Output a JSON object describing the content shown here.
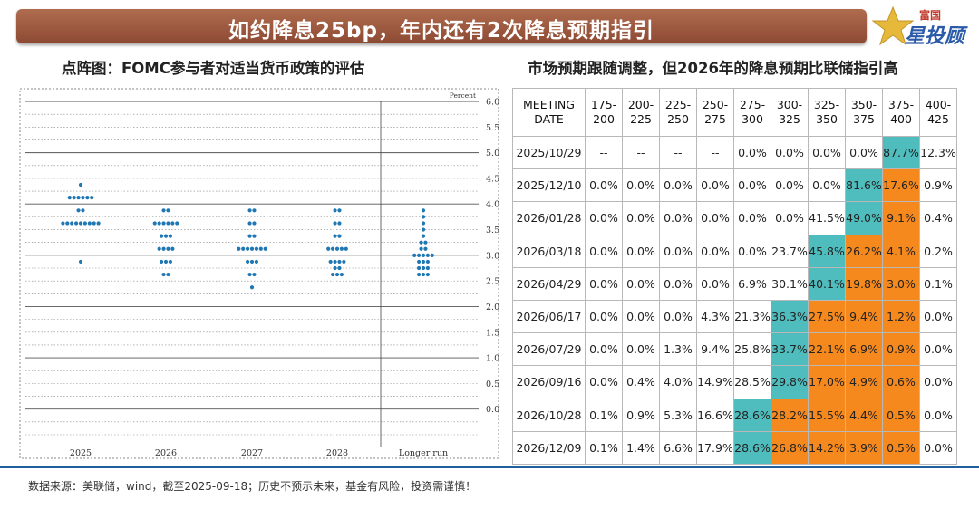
{
  "banner": {
    "title": "如约降息25bp，年内还有2次降息预期指引"
  },
  "logo": {
    "top": "富国",
    "main": "星投顾"
  },
  "left_chart": {
    "subtitle": "点阵图：FOMC参与者对适当货币政策的评估"
  },
  "right_table": {
    "subtitle": "市场预期跟随调整，但2026年的降息预期比联储指引高"
  },
  "footer": {
    "text": "数据来源：美联储，wind，截至2025-09-18；历史不预示未来，基金有风险，投资需谨慎！"
  },
  "colors": {
    "banner": "#9a5840",
    "dot": "#1f77b4",
    "teal": "#4fbdbd",
    "orange": "#f5891e",
    "footer_line": "#1f5f9e"
  },
  "chart_data": [
    {
      "type": "scatter",
      "title": "",
      "ylabel": "Percent",
      "ylim": [
        -0.5,
        6.0
      ],
      "yticks": [
        "6.0",
        "5.5",
        "5.0",
        "4.5",
        "4.0",
        "3.5",
        "3.0",
        "2.5",
        "2.0",
        "1.5",
        "1.0",
        "0.5",
        "0.0"
      ],
      "categories": [
        "2025",
        "2026",
        "2027",
        "2028",
        "Longer run"
      ],
      "dots": [
        {
          "category": "2025",
          "rate": 4.375,
          "count": 1
        },
        {
          "category": "2025",
          "rate": 4.125,
          "count": 6
        },
        {
          "category": "2025",
          "rate": 3.875,
          "count": 2
        },
        {
          "category": "2025",
          "rate": 3.625,
          "count": 9
        },
        {
          "category": "2025",
          "rate": 2.875,
          "count": 1
        },
        {
          "category": "2026",
          "rate": 3.875,
          "count": 2
        },
        {
          "category": "2026",
          "rate": 3.625,
          "count": 6
        },
        {
          "category": "2026",
          "rate": 3.375,
          "count": 3
        },
        {
          "category": "2026",
          "rate": 3.125,
          "count": 4
        },
        {
          "category": "2026",
          "rate": 2.875,
          "count": 3
        },
        {
          "category": "2026",
          "rate": 2.625,
          "count": 2
        },
        {
          "category": "2027",
          "rate": 3.875,
          "count": 2
        },
        {
          "category": "2027",
          "rate": 3.625,
          "count": 2
        },
        {
          "category": "2027",
          "rate": 3.375,
          "count": 2
        },
        {
          "category": "2027",
          "rate": 3.125,
          "count": 7
        },
        {
          "category": "2027",
          "rate": 2.875,
          "count": 3
        },
        {
          "category": "2027",
          "rate": 2.625,
          "count": 2
        },
        {
          "category": "2027",
          "rate": 2.375,
          "count": 1
        },
        {
          "category": "2028",
          "rate": 3.875,
          "count": 2
        },
        {
          "category": "2028",
          "rate": 3.625,
          "count": 2
        },
        {
          "category": "2028",
          "rate": 3.375,
          "count": 2
        },
        {
          "category": "2028",
          "rate": 3.125,
          "count": 5
        },
        {
          "category": "2028",
          "rate": 2.875,
          "count": 4
        },
        {
          "category": "2028",
          "rate": 2.75,
          "count": 2
        },
        {
          "category": "2028",
          "rate": 2.625,
          "count": 3
        },
        {
          "category": "Longer run",
          "rate": 3.875,
          "count": 1
        },
        {
          "category": "Longer run",
          "rate": 3.75,
          "count": 1
        },
        {
          "category": "Longer run",
          "rate": 3.625,
          "count": 1
        },
        {
          "category": "Longer run",
          "rate": 3.5,
          "count": 1
        },
        {
          "category": "Longer run",
          "rate": 3.375,
          "count": 1
        },
        {
          "category": "Longer run",
          "rate": 3.25,
          "count": 2
        },
        {
          "category": "Longer run",
          "rate": 3.125,
          "count": 2
        },
        {
          "category": "Longer run",
          "rate": 3.0,
          "count": 5
        },
        {
          "category": "Longer run",
          "rate": 2.875,
          "count": 3
        },
        {
          "category": "Longer run",
          "rate": 2.75,
          "count": 3
        },
        {
          "category": "Longer run",
          "rate": 2.625,
          "count": 3
        }
      ]
    },
    {
      "type": "table",
      "header_first_line1": "MEETING",
      "header_first_line2": "DATE",
      "columns": [
        [
          "175-",
          "200"
        ],
        [
          "200-",
          "225"
        ],
        [
          "225-",
          "250"
        ],
        [
          "250-",
          "275"
        ],
        [
          "275-",
          "300"
        ],
        [
          "300-",
          "325"
        ],
        [
          "325-",
          "350"
        ],
        [
          "350-",
          "375"
        ],
        [
          "375-",
          "400"
        ],
        [
          "400-",
          "425"
        ]
      ],
      "rows": [
        {
          "date": "2025/10/29",
          "values": [
            "--",
            "--",
            "--",
            "--",
            "0.0%",
            "0.0%",
            "0.0%",
            "0.0%",
            "87.7%",
            "12.3%"
          ],
          "teal": [
            8
          ],
          "orange": []
        },
        {
          "date": "2025/12/10",
          "values": [
            "0.0%",
            "0.0%",
            "0.0%",
            "0.0%",
            "0.0%",
            "0.0%",
            "0.0%",
            "81.6%",
            "17.6%",
            "0.9%"
          ],
          "teal": [
            7
          ],
          "orange": [
            8
          ]
        },
        {
          "date": "2026/01/28",
          "values": [
            "0.0%",
            "0.0%",
            "0.0%",
            "0.0%",
            "0.0%",
            "0.0%",
            "41.5%",
            "49.0%",
            "9.1%",
            "0.4%"
          ],
          "teal": [
            7
          ],
          "orange": [
            8
          ]
        },
        {
          "date": "2026/03/18",
          "values": [
            "0.0%",
            "0.0%",
            "0.0%",
            "0.0%",
            "0.0%",
            "23.7%",
            "45.8%",
            "26.2%",
            "4.1%",
            "0.2%"
          ],
          "teal": [
            6
          ],
          "orange": [
            7,
            8
          ]
        },
        {
          "date": "2026/04/29",
          "values": [
            "0.0%",
            "0.0%",
            "0.0%",
            "0.0%",
            "6.9%",
            "30.1%",
            "40.1%",
            "19.8%",
            "3.0%",
            "0.1%"
          ],
          "teal": [
            6
          ],
          "orange": [
            7,
            8
          ]
        },
        {
          "date": "2026/06/17",
          "values": [
            "0.0%",
            "0.0%",
            "0.0%",
            "4.3%",
            "21.3%",
            "36.3%",
            "27.5%",
            "9.4%",
            "1.2%",
            "0.0%"
          ],
          "teal": [
            5
          ],
          "orange": [
            6,
            7,
            8
          ]
        },
        {
          "date": "2026/07/29",
          "values": [
            "0.0%",
            "0.0%",
            "1.3%",
            "9.4%",
            "25.8%",
            "33.7%",
            "22.1%",
            "6.9%",
            "0.9%",
            "0.0%"
          ],
          "teal": [
            5
          ],
          "orange": [
            6,
            7,
            8
          ]
        },
        {
          "date": "2026/09/16",
          "values": [
            "0.0%",
            "0.4%",
            "4.0%",
            "14.9%",
            "28.5%",
            "29.8%",
            "17.0%",
            "4.9%",
            "0.6%",
            "0.0%"
          ],
          "teal": [
            5
          ],
          "orange": [
            6,
            7,
            8
          ]
        },
        {
          "date": "2026/10/28",
          "values": [
            "0.1%",
            "0.9%",
            "5.3%",
            "16.6%",
            "28.6%",
            "28.2%",
            "15.5%",
            "4.4%",
            "0.5%",
            "0.0%"
          ],
          "teal": [
            4
          ],
          "orange": [
            5,
            6,
            7,
            8
          ]
        },
        {
          "date": "2026/12/09",
          "values": [
            "0.1%",
            "1.4%",
            "6.6%",
            "17.9%",
            "28.6%",
            "26.8%",
            "14.2%",
            "3.9%",
            "0.5%",
            "0.0%"
          ],
          "teal": [
            4
          ],
          "orange": [
            5,
            6,
            7,
            8
          ]
        }
      ]
    }
  ]
}
